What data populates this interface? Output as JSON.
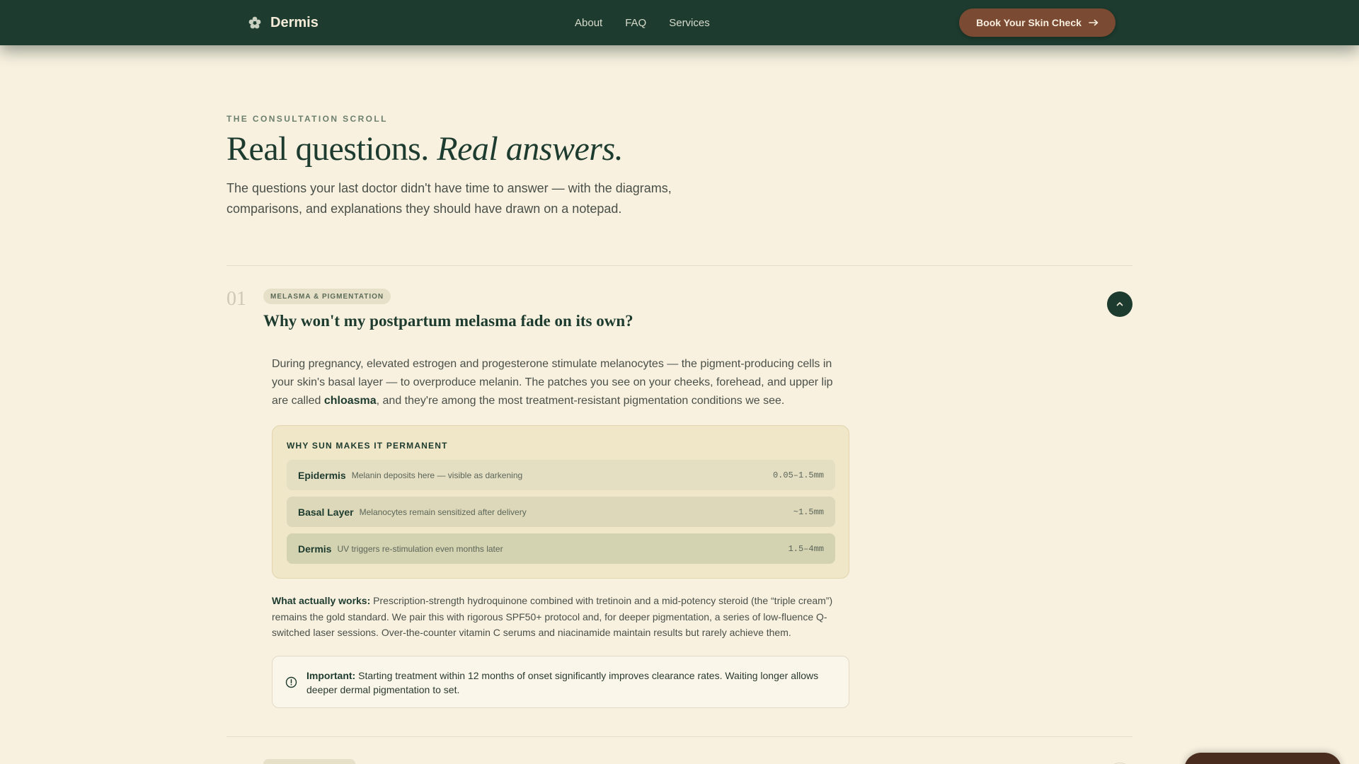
{
  "nav": {
    "brand": "Dermis",
    "brand_icon": "flower-icon",
    "links": [
      "About",
      "FAQ",
      "Services"
    ],
    "cta_label": "Book Your Skin Check",
    "cta_icon": "arrow-right-icon"
  },
  "hero": {
    "eyebrow": "THE CONSULTATION SCROLL",
    "headline_plain": "Real questions.",
    "headline_italic": "Real answers.",
    "lede": "The questions your last doctor didn't have time to answer — with the diagrams, comparisons, and explanations they should have drawn on a notepad."
  },
  "faq": {
    "number": "01",
    "tag": "MELASMA & PIGMENTATION",
    "question": "Why won't my postpartum melasma fade on its own?",
    "toggle_icon": "chevron-up-icon",
    "answer_before": "During pregnancy, elevated estrogen and progesterone stimulate melanocytes — the pigment-producing cells in your skin's basal layer — to overproduce melanin. The patches you see on your cheeks, forehead, and upper lip are called ",
    "answer_term": "chloasma",
    "answer_after": ", and they're among the most treatment-resistant pigmentation conditions we see.",
    "layers_title": "WHY SUN MAKES IT PERMANENT",
    "layers": [
      {
        "name": "Epidermis",
        "desc": "Melanin deposits here — visible as darkening",
        "depth": "0.05–1.5mm"
      },
      {
        "name": "Basal Layer",
        "desc": "Melanocytes remain sensitized after delivery",
        "depth": "~1.5mm"
      },
      {
        "name": "Dermis",
        "desc": "UV triggers re-stimulation even months later",
        "depth": "1.5–4mm"
      }
    ],
    "works_label": "What actually works:",
    "works_text": " Prescription-strength hydroquinone combined with tretinoin and a mid-potency steroid (the “triple cream”) remains the gold standard. We pair this with rigorous SPF50+ protocol and, for deeper pigmentation, a series of low-fluence Q-switched laser sessions. Over-the-counter vitamin C serums and niacinamide maintain results but rarely achieve them.",
    "note_icon": "info-circle-icon",
    "note_label": "Important:",
    "note_text": " Starting treatment within 12 months of onset significantly improves clearance rates. Waiting longer allows deeper dermal pigmentation to set."
  },
  "colors": {
    "nav_bg": "#1d3b2e",
    "page_bg": "#f8f1e0",
    "cta_bg": "#7a4a32",
    "heading": "#1d3b2e"
  }
}
